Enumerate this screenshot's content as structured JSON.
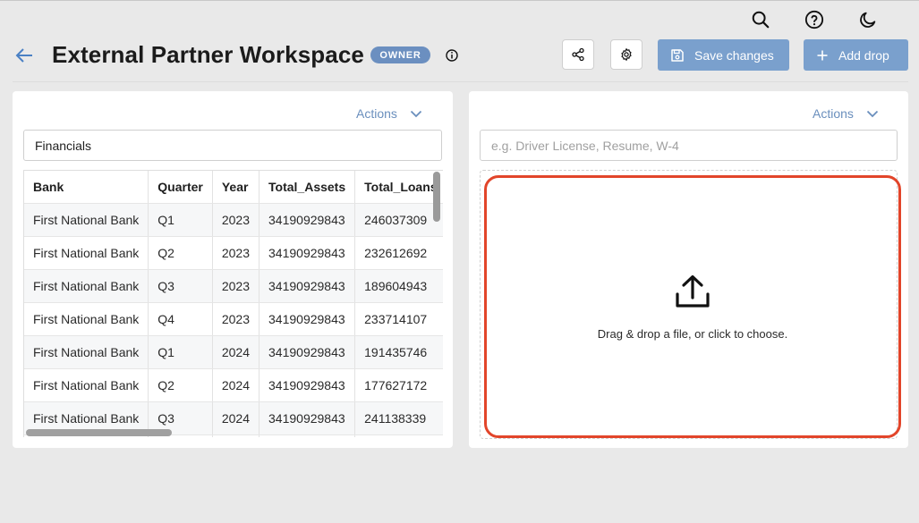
{
  "header": {
    "title": "External Partner Workspace",
    "badge": "OWNER",
    "save_label": "Save changes",
    "add_drop_label": "Add drop"
  },
  "icons": {
    "search": "search-icon",
    "help": "help-icon",
    "theme": "moon-icon",
    "back": "arrow-left-icon",
    "info": "info-icon",
    "share": "share-icon",
    "settings": "gear-icon",
    "save": "floppy-disk-icon",
    "add": "plus-icon",
    "upload": "upload-icon",
    "chevron": "chevron-down-icon"
  },
  "colors": {
    "accent": "#7aa0cd",
    "badge": "#6b8fc0",
    "link": "#6a8fbd",
    "dropzone_border": "#e2452a"
  },
  "left_panel": {
    "actions_label": "Actions",
    "name_value": "Financials",
    "table": {
      "columns": [
        "Bank",
        "Quarter",
        "Year",
        "Total_Assets",
        "Total_Loans"
      ],
      "rows": [
        [
          "First National Bank",
          "Q1",
          "2023",
          "34190929843",
          "246037309"
        ],
        [
          "First National Bank",
          "Q2",
          "2023",
          "34190929843",
          "232612692"
        ],
        [
          "First National Bank",
          "Q3",
          "2023",
          "34190929843",
          "189604943"
        ],
        [
          "First National Bank",
          "Q4",
          "2023",
          "34190929843",
          "233714107"
        ],
        [
          "First National Bank",
          "Q1",
          "2024",
          "34190929843",
          "191435746"
        ],
        [
          "First National Bank",
          "Q2",
          "2024",
          "34190929843",
          "177627172"
        ],
        [
          "First National Bank",
          "Q3",
          "2024",
          "34190929843",
          "241138339"
        ],
        [
          "",
          "",
          "",
          "",
          ""
        ]
      ]
    }
  },
  "right_panel": {
    "actions_label": "Actions",
    "name_placeholder": "e.g. Driver License, Resume, W-4",
    "dropzone_text": "Drag & drop a file, or click to choose."
  }
}
